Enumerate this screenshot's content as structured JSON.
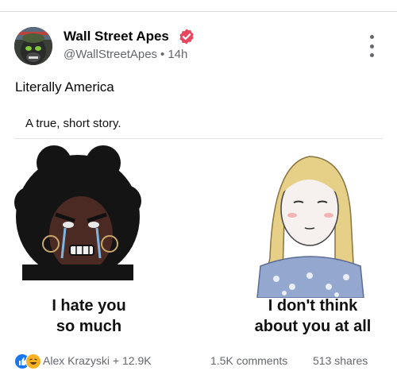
{
  "post": {
    "author_name": "Wall Street Apes",
    "handle": "@WallStreetApes",
    "separator": "•",
    "time_ago": "14h",
    "text": "Literally America"
  },
  "meme": {
    "caption": "A true, short story.",
    "left_text_line1": "I hate you",
    "left_text_line2": "so much",
    "right_text_line1": "I don't think",
    "right_text_line2": "about you at all"
  },
  "footer": {
    "reactors": "Alex Krazyski + 12.9K",
    "comments": "1.5K comments",
    "shares": "513 shares"
  },
  "icons": {
    "verified": "verified-badge-icon",
    "more": "more-vertical-icon",
    "like": "like-reaction-icon",
    "haha": "haha-reaction-icon"
  },
  "colors": {
    "verified_badge": "#e8475f",
    "like_blue": "#1877f2",
    "haha_yellow": "#f7b125",
    "secondary_text": "#65676b"
  }
}
